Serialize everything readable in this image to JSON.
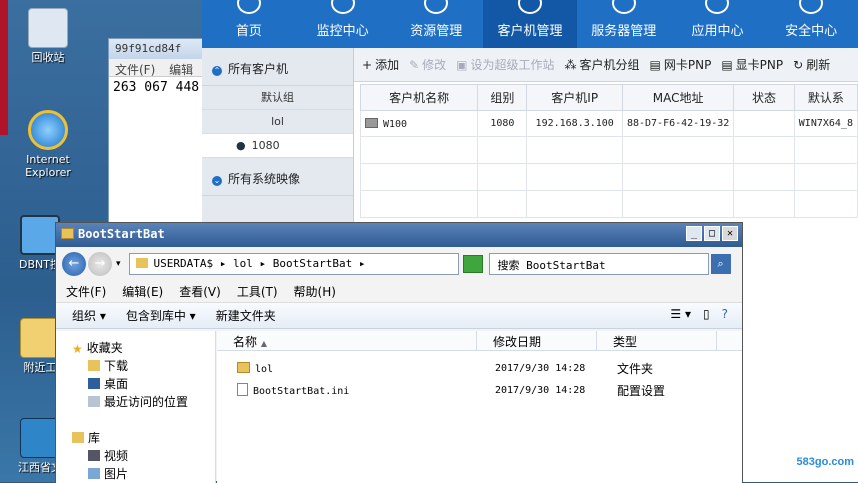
{
  "desktop": {
    "icons": [
      {
        "label": "回收站"
      },
      {
        "label": "Internet Explorer"
      },
      {
        "label": "DBNT控"
      },
      {
        "label": "附近工"
      },
      {
        "label": "江西省文"
      }
    ]
  },
  "notepad": {
    "title": "99f91cd84f",
    "menu": [
      "文件(F)",
      "编辑"
    ],
    "content": "263 067 448"
  },
  "app": {
    "nav": [
      {
        "label": "首页",
        "active": false
      },
      {
        "label": "监控中心",
        "active": false
      },
      {
        "label": "资源管理",
        "active": false
      },
      {
        "label": "客户机管理",
        "active": true
      },
      {
        "label": "服务器管理",
        "active": false
      },
      {
        "label": "应用中心",
        "active": false
      },
      {
        "label": "安全中心",
        "active": false
      }
    ],
    "sidebar": {
      "clients_header": "所有客户机",
      "groups": [
        "默认组",
        "lol",
        "1080"
      ],
      "images_header": "所有系统映像"
    },
    "toolbar": [
      {
        "icon": "plus-icon",
        "label": "添加",
        "enabled": true
      },
      {
        "icon": "edit-icon",
        "label": "修改",
        "enabled": false
      },
      {
        "icon": "superuser-icon",
        "label": "设为超级工作站",
        "enabled": false
      },
      {
        "icon": "group-icon",
        "label": "客户机分组",
        "enabled": true
      },
      {
        "icon": "nic-icon",
        "label": "网卡PNP",
        "enabled": true
      },
      {
        "icon": "display-icon",
        "label": "显卡PNP",
        "enabled": true
      },
      {
        "icon": "refresh-icon",
        "label": "刷新",
        "enabled": true
      }
    ],
    "table": {
      "columns": [
        "客户机名称",
        "组别",
        "客户机IP",
        "MAC地址",
        "状态",
        "默认系"
      ],
      "rows": [
        {
          "name": "W100",
          "group": "1080",
          "ip": "192.168.3.100",
          "mac": "88-D7-F6-42-19-32",
          "status": "",
          "system": "WIN7X64_8"
        }
      ]
    }
  },
  "explorer": {
    "title": "BootStartBat",
    "address": "USERDATA$ ▸ lol ▸ BootStartBat ▸",
    "search_placeholder": "搜索 BootStartBat",
    "menu": [
      "文件(F)",
      "编辑(E)",
      "查看(V)",
      "工具(T)",
      "帮助(H)"
    ],
    "commands": [
      "组织 ▾",
      "包含到库中 ▾",
      "新建文件夹"
    ],
    "tree": [
      {
        "label": "收藏夹",
        "icon": "star-icon"
      },
      {
        "label": "下载",
        "icon": "download-folder-icon"
      },
      {
        "label": "桌面",
        "icon": "desktop-folder-icon"
      },
      {
        "label": "最近访问的位置",
        "icon": "recent-places-icon"
      },
      {
        "label": "库",
        "icon": "library-icon"
      },
      {
        "label": "视频",
        "icon": "video-library-icon"
      },
      {
        "label": "图片",
        "icon": "picture-library-icon"
      }
    ],
    "columns": [
      "名称",
      "修改日期",
      "类型"
    ],
    "files": [
      {
        "name": "lol",
        "date": "2017/9/30 14:28",
        "type": "文件夹",
        "icon": "folder-icon"
      },
      {
        "name": "BootStartBat.ini",
        "date": "2017/9/30 14:28",
        "type": "配置设置",
        "icon": "ini-file-icon"
      }
    ]
  },
  "watermark": "583go.com"
}
